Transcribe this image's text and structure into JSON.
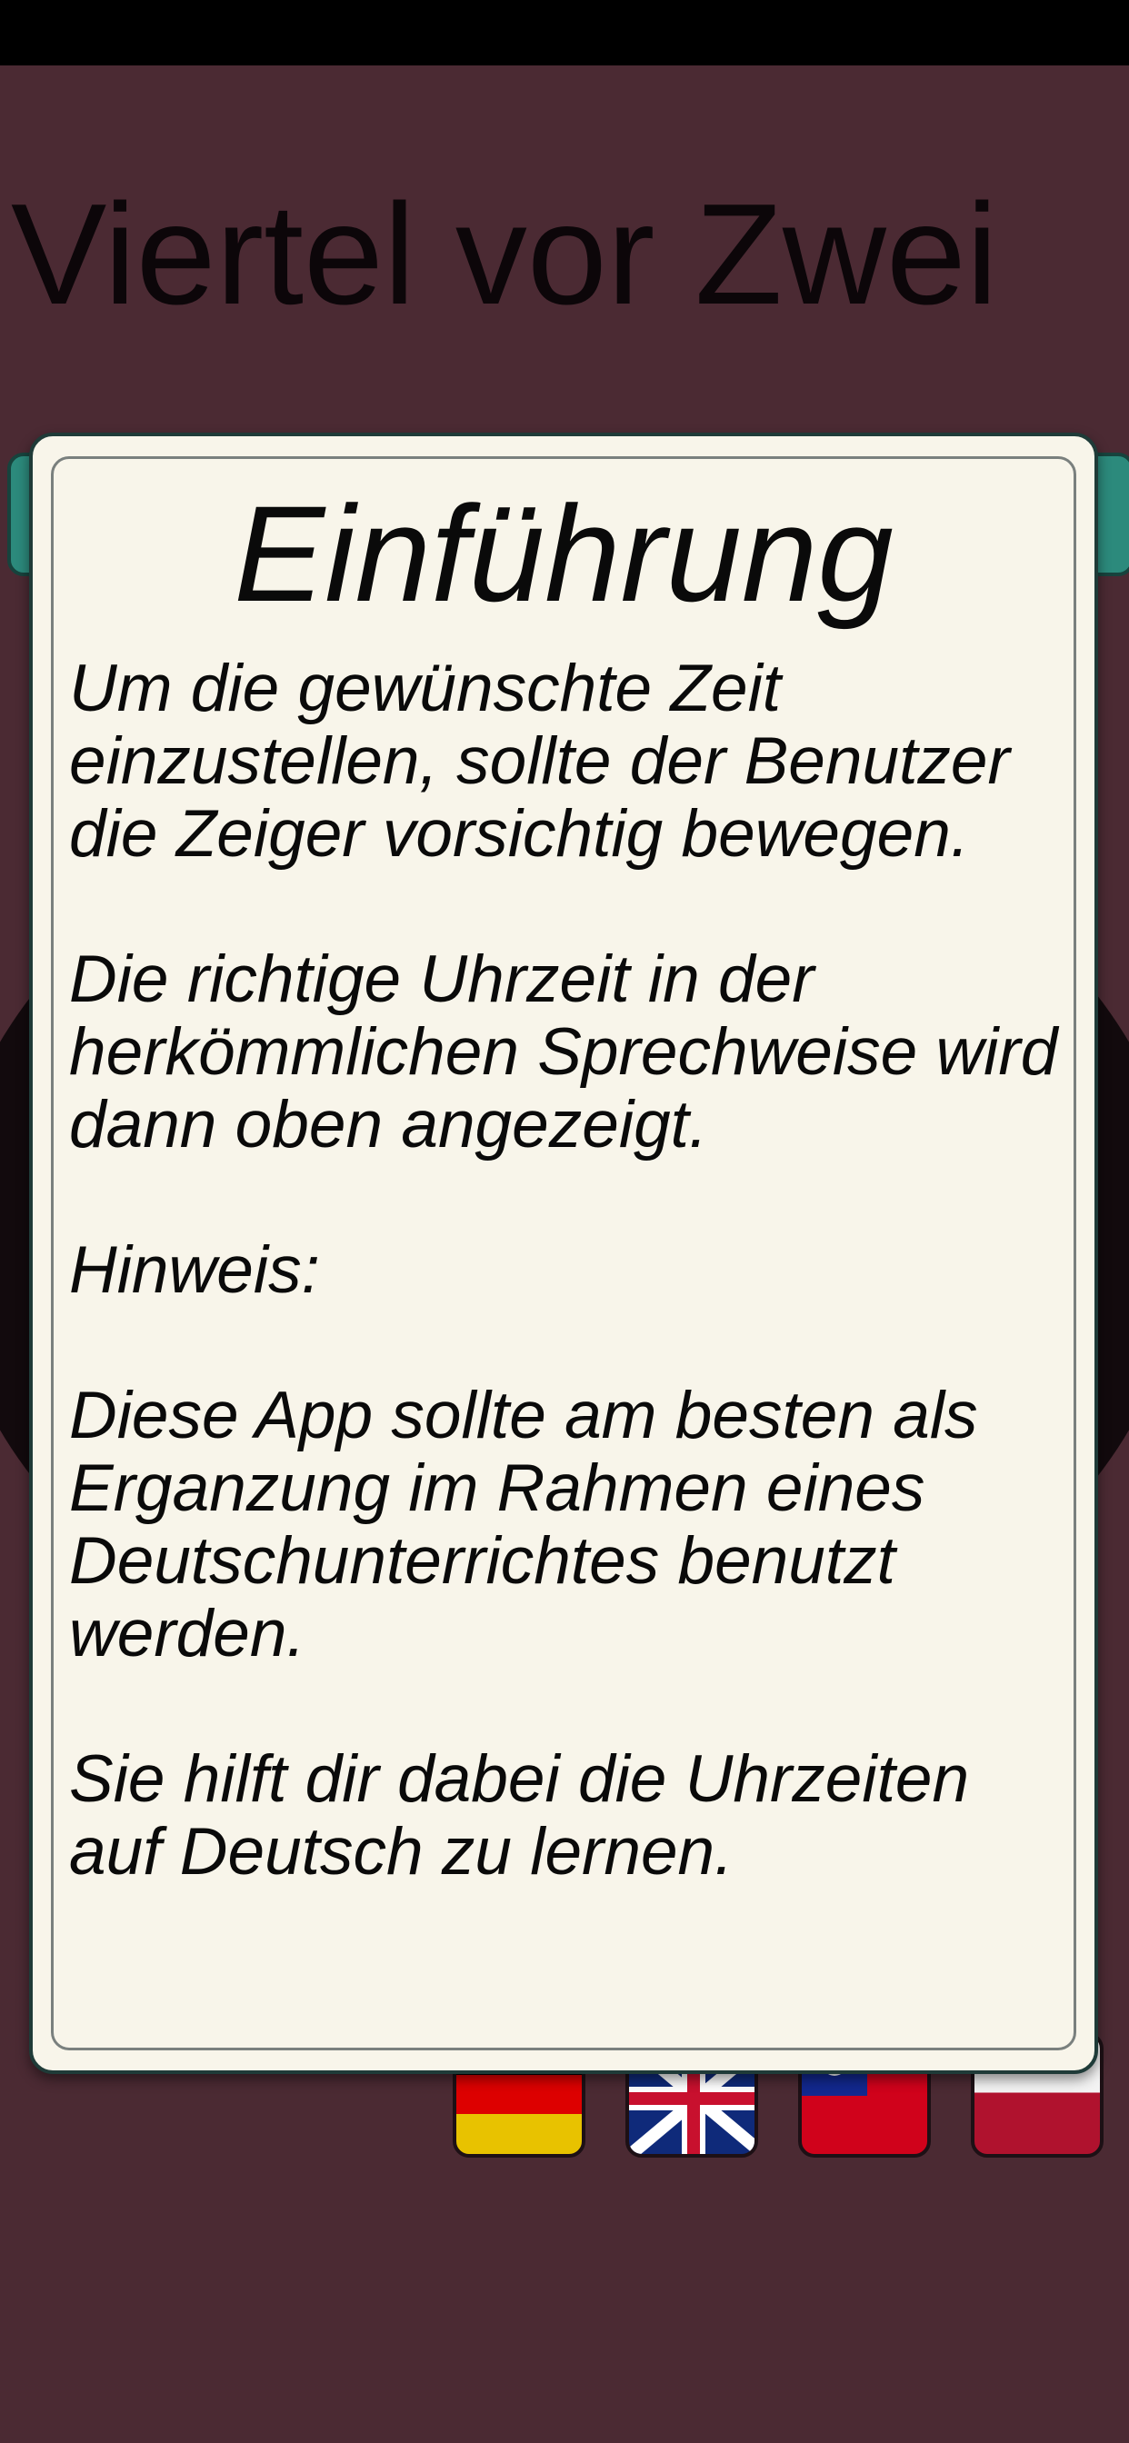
{
  "header": {
    "time_text": "Viertel vor Zwei"
  },
  "flags": [
    {
      "name": "german-flag",
      "colors": [
        "#000000",
        "#dd0000",
        "#e8c200"
      ]
    },
    {
      "name": "uk-flag",
      "colors": [
        "#0f2a7a",
        "#ffffff",
        "#c8102e"
      ]
    },
    {
      "name": "taiwan-flag",
      "colors": [
        "#12288e",
        "#d0021b",
        "#ffffff"
      ]
    },
    {
      "name": "polish-flag",
      "colors": [
        "#f3f3f3",
        "#b0122e"
      ]
    }
  ],
  "dialog": {
    "title": "Einführung",
    "paragraphs": [
      "Um die gewünschte Zeit einzustellen, sollte der Benutzer die Zeiger vorsichtig bewegen.",
      "Die richtige Uhrzeit in der herkömmlichen Sprechweise wird dann oben angezeigt.",
      "Hinweis:",
      "Diese App sollte am besten als Erganzung im Rahmen eines Deutschunterrichtes benutzt werden.",
      "Sie hilft dir dabei die Uhrzeiten auf Deutsch zu lernen."
    ]
  },
  "colors": {
    "background": "#4b2a33",
    "dialog_background": "#f8f5ea",
    "accent_teal": "#2c8a7c"
  }
}
